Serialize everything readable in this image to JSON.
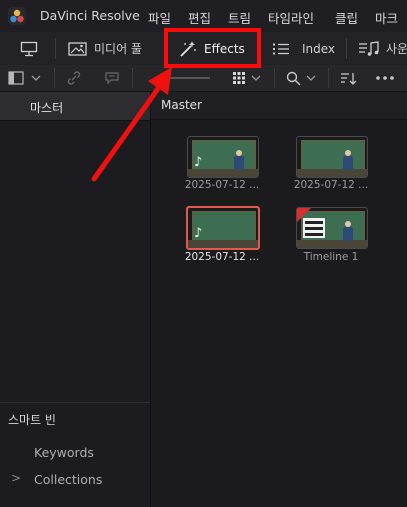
{
  "menubar": {
    "app_name": "DaVinci Resolve",
    "items": [
      "파일",
      "편집",
      "트림",
      "타임라인",
      "클립",
      "마크"
    ]
  },
  "toolbar": {
    "media_pool_label": "미디어 풀",
    "effects_label": "Effects",
    "index_label": "Index",
    "sound_label": "사운"
  },
  "sidebar": {
    "master_bin": "마스터",
    "smart_bins_header": "스마트 빈",
    "keywords": "Keywords",
    "collections": "Collections",
    "collections_chevron": ">"
  },
  "content": {
    "header": "Master",
    "clips": [
      {
        "label": "2025-07-12 ...",
        "type": "audio-video",
        "selected": false
      },
      {
        "label": "2025-07-12 ...",
        "type": "video",
        "selected": false
      },
      {
        "label": "2025-07-12 ...",
        "type": "audio-video",
        "selected": true
      },
      {
        "label": "Timeline 1",
        "type": "timeline",
        "selected": false
      }
    ]
  },
  "colors": {
    "highlight_box": "#ff0a0a",
    "selection": "#e05a50",
    "background": "#1e1e22"
  },
  "icons": [
    "davinci-logo-icon",
    "monitor-icon",
    "media-pool-icon",
    "effects-wand-icon",
    "index-list-icon",
    "sound-library-icon",
    "panel-toggle-icon",
    "chevron-down-icon",
    "link-icon",
    "comment-icon",
    "grid-view-icon",
    "search-icon",
    "sort-icon",
    "more-icon",
    "music-note-icon"
  ]
}
